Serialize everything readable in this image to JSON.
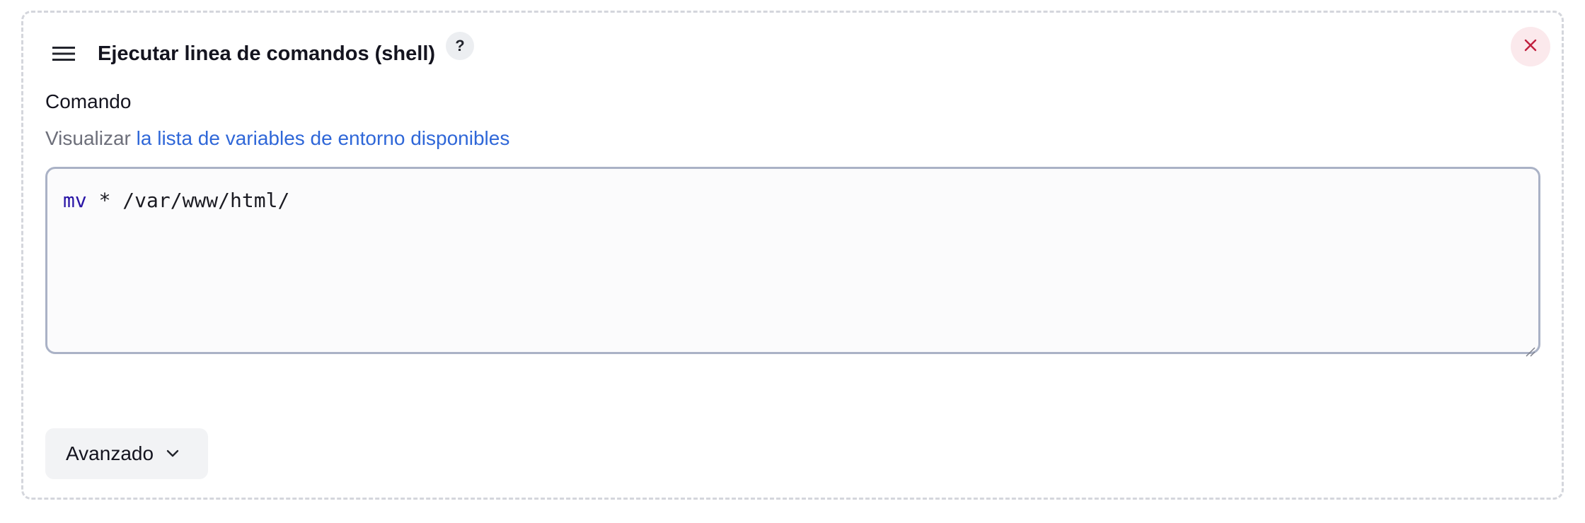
{
  "section": {
    "title": "Ejecutar linea de comandos (shell)",
    "help_label": "?",
    "drag_icon": "hamburger-menu-icon",
    "close_icon": "close-x-icon"
  },
  "command_field": {
    "label": "Comando",
    "description_prefix": "Visualizar",
    "description_link": "la lista de variables de entorno disponibles",
    "value_keyword": "mv",
    "value_rest": " * /var/www/html/"
  },
  "advanced": {
    "label": "Avanzado",
    "icon": "chevron-down-icon"
  },
  "colors": {
    "link": "#2f67d8",
    "close_icon": "#c0203f",
    "close_bg": "#fbe9ec",
    "keyword": "#2a16a6",
    "editor_border": "#aab2c6"
  }
}
